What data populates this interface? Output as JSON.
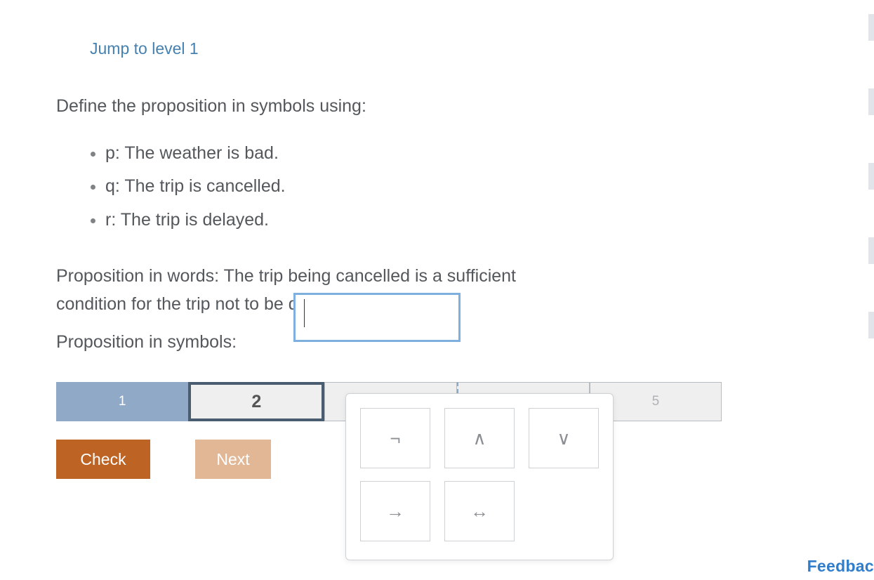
{
  "jump_link": "Jump to level 1",
  "prompt": "Define the proposition in symbols using:",
  "definitions": [
    "p: The weather is bad.",
    "q: The trip is cancelled.",
    "r: The trip is delayed."
  ],
  "words_label": "Proposition in words: ",
  "words_text": "The trip being cancelled is a sufficient condition for the trip not to be delayed.",
  "symbols_label": "Proposition in symbols:",
  "symbols_value": "",
  "levels": {
    "l1": "1",
    "l2": "2",
    "l3": "",
    "l4": "",
    "l5": "5"
  },
  "buttons": {
    "check": "Check",
    "next": "Next"
  },
  "palette": {
    "not": "¬",
    "and": "∧",
    "or": "∨",
    "implies": "→",
    "iff": "↔"
  },
  "sidebar": {
    "feedback": "Feedbac"
  }
}
